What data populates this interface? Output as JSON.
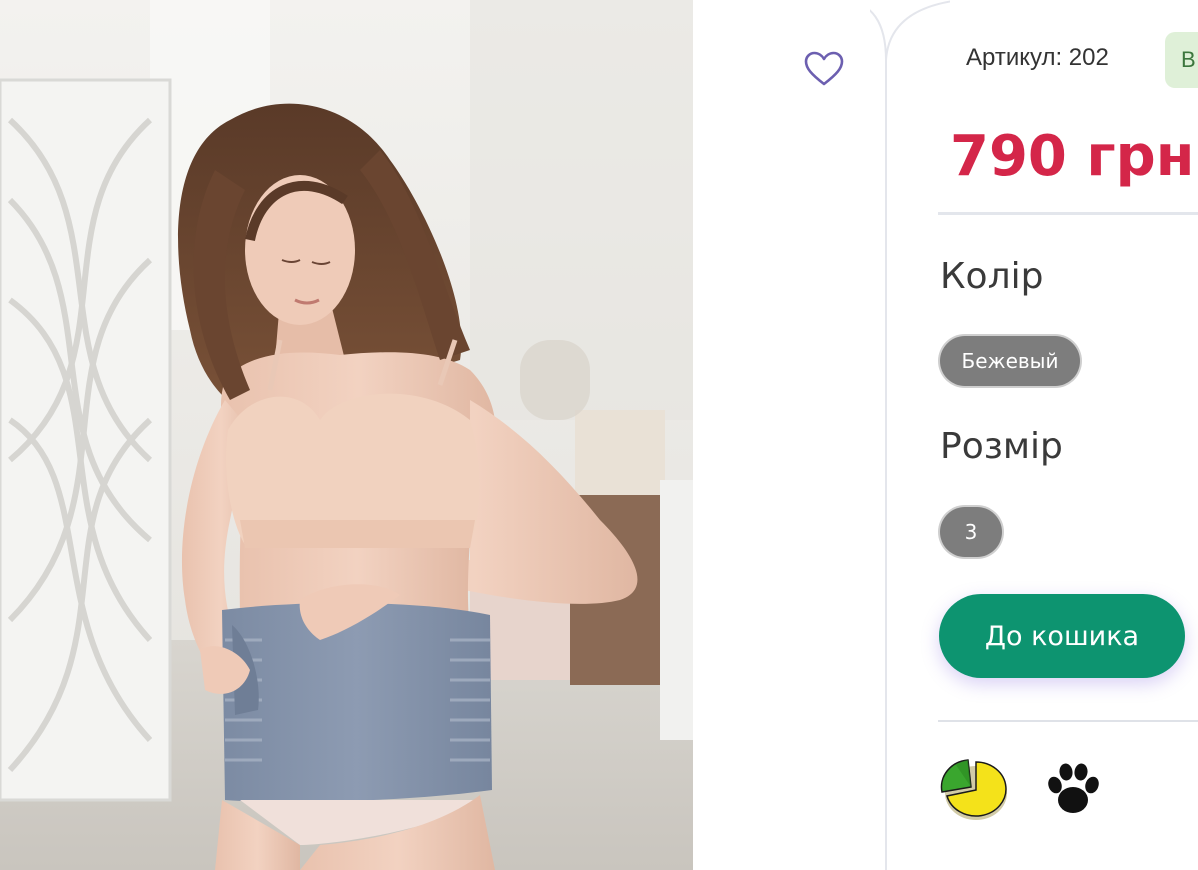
{
  "product": {
    "sku_text": "Артикул: 202",
    "stock_badge": "В",
    "price": "790 грн",
    "color_section": {
      "title": "Колір",
      "selected": "Бежевый"
    },
    "size_section": {
      "title": "Розмір",
      "selected": "3"
    },
    "add_to_cart_label": "До кошика"
  },
  "icons": {
    "favorite": "heart-outline-icon",
    "feature_1": "pie-chart-icon",
    "feature_2": "paw-print-icon"
  },
  "colors": {
    "price": "#d42649",
    "cart_button": "#0d9470",
    "chip": "#7d7d7d",
    "heart": "#6c5fb0",
    "stock_badge_bg": "#dff0d8"
  }
}
